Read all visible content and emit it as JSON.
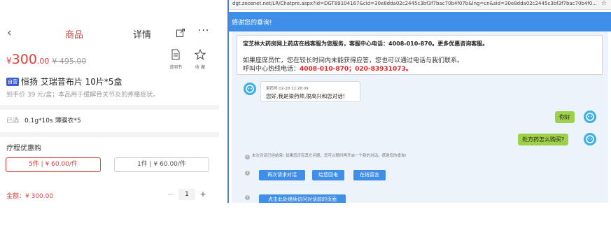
{
  "app": {
    "nav": {
      "back_icon": "chevron-left-icon",
      "tab_goods": "商品",
      "tab_detail": "详情",
      "share_icon": "share-icon",
      "more": "···"
    },
    "price": {
      "currency": "¥",
      "integer": "300",
      "decimal": ".00",
      "original": "¥ 495.00"
    },
    "actions": {
      "manual_label": "说明书",
      "fav_label": "收 藏"
    },
    "product": {
      "badge": "自营",
      "title": "恒扬 艾瑞昔布片 10片*5盒",
      "subtitle": "到手价 39 元/盒；本品用于缓解骨关节炎的疼痛症状。"
    },
    "selected": {
      "label": "已选",
      "value": "0.1g*10s 薄膜衣*5"
    },
    "course": {
      "title": "疗程优惠购",
      "option1": "5件 | ¥ 60.00/件",
      "option2": "1件 | ¥ 60.00/件"
    },
    "amount": {
      "label": "金额：¥ 300.00",
      "qty": "1",
      "minus": "−",
      "plus": "+"
    }
  },
  "browser": {
    "url": "dgt.zoosnet.net/LR/Chatpre.aspx?id=DGT89104167&cid=30e8dda02c2445c3bf3f7bac70b4f07b&lng=cn&sid=30e8dda02c2445c3bf3f7bac70b4f0...",
    "star": "☆"
  },
  "chat": {
    "header": "感谢您的垂询!",
    "notice": {
      "line1": "宝芝林大药房网上药店在线客服为您服务，客服中心电话：4008-010-870。更多优惠咨询客服。",
      "line2": "如果座席员忙，您在较长时间内未能获得应答，您也可以通过电话与我们联系。",
      "line3_prefix": "呼叫中心热线电话：",
      "line3_phones": "4008-010-870；020-83931073。"
    },
    "agent_msg": {
      "meta": "梁药师  02-28 12:26:09",
      "text": "您好,我是梁药师,很高兴和您对话!"
    },
    "user_msg1": "你好",
    "user_msg2": "处方药怎么购买?",
    "system_note": "本次对话已经结束! 如果您还有其它问题，您可以随时再开启一个新的对话。感谢您的垂询!",
    "btn_again": "再次请求对话",
    "btn_callback": "给您回电",
    "btn_leave_msg": "在线留言",
    "btn_partial": "点击此处继续访问对话前的页面"
  },
  "colors": {
    "brand_red": "#e23c3c",
    "chat_blue": "#3f8ee8",
    "user_bubble": "#9ed148"
  }
}
